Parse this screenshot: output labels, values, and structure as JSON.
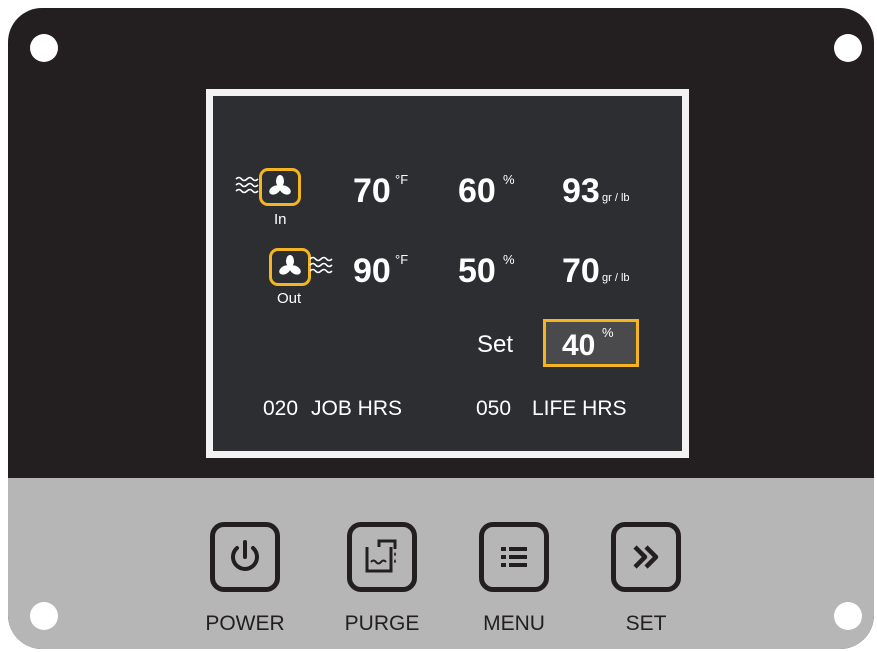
{
  "inlet": {
    "label": "In",
    "temp_value": "70",
    "temp_unit": "°F",
    "rh_value": "60",
    "rh_unit": "%",
    "grains_value": "93",
    "grains_unit": "gr / lb"
  },
  "outlet": {
    "label": "Out",
    "temp_value": "90",
    "temp_unit": "°F",
    "rh_value": "50",
    "rh_unit": "%",
    "grains_value": "70",
    "grains_unit": "gr / lb"
  },
  "setpoint": {
    "label": "Set",
    "value": "40",
    "unit": "%"
  },
  "hours": {
    "job_value": "020",
    "job_label": "JOB HRS",
    "life_value": "050",
    "life_label": "LIFE HRS"
  },
  "buttons": {
    "power": "POWER",
    "purge": "PURGE",
    "menu": "MENU",
    "set": "SET"
  },
  "icons": {
    "fan": "fan-icon",
    "airflow": "airflow-waves-icon",
    "power": "power-icon",
    "purge": "purge-tank-icon",
    "menu": "menu-list-icon",
    "set": "double-chevron-right-icon"
  },
  "colors": {
    "panel": "#231f20",
    "screen": "#2d2e32",
    "accent": "#f4b521",
    "keypad": "#b6b6b6"
  }
}
